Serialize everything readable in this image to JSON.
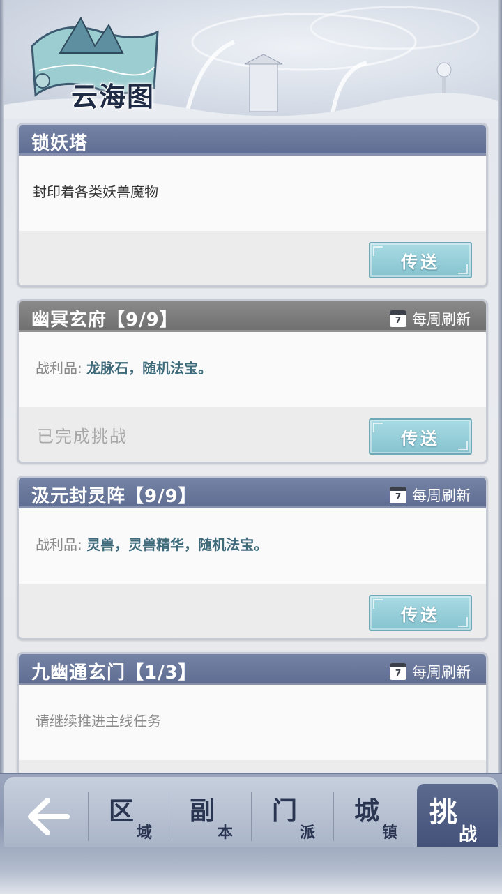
{
  "header": {
    "title": "云海图"
  },
  "cards": [
    {
      "title": "锁妖塔",
      "description": "封印着各类妖兽魔物",
      "button": "传送"
    },
    {
      "title": "幽冥玄府【9/9】",
      "refresh_label": "每周刷新",
      "calendar_day": "7",
      "loot_label": "战利品:",
      "loot_value": "龙脉石，随机法宝。",
      "status": "已完成挑战",
      "button": "传送"
    },
    {
      "title": "汲元封灵阵【9/9】",
      "refresh_label": "每周刷新",
      "calendar_day": "7",
      "loot_label": "战利品:",
      "loot_value": "灵兽，灵兽精华，随机法宝。",
      "button": "传送"
    },
    {
      "title": "九幽通玄门【1/3】",
      "refresh_label": "每周刷新",
      "calendar_day": "7",
      "description": "请继续推进主线任务"
    }
  ],
  "nav": {
    "tabs": [
      {
        "main": "区",
        "sub": "域"
      },
      {
        "main": "副",
        "sub": "本"
      },
      {
        "main": "门",
        "sub": "派"
      },
      {
        "main": "城",
        "sub": "镇"
      },
      {
        "main": "挑",
        "sub": "战"
      }
    ],
    "active_tab": "挑战"
  }
}
